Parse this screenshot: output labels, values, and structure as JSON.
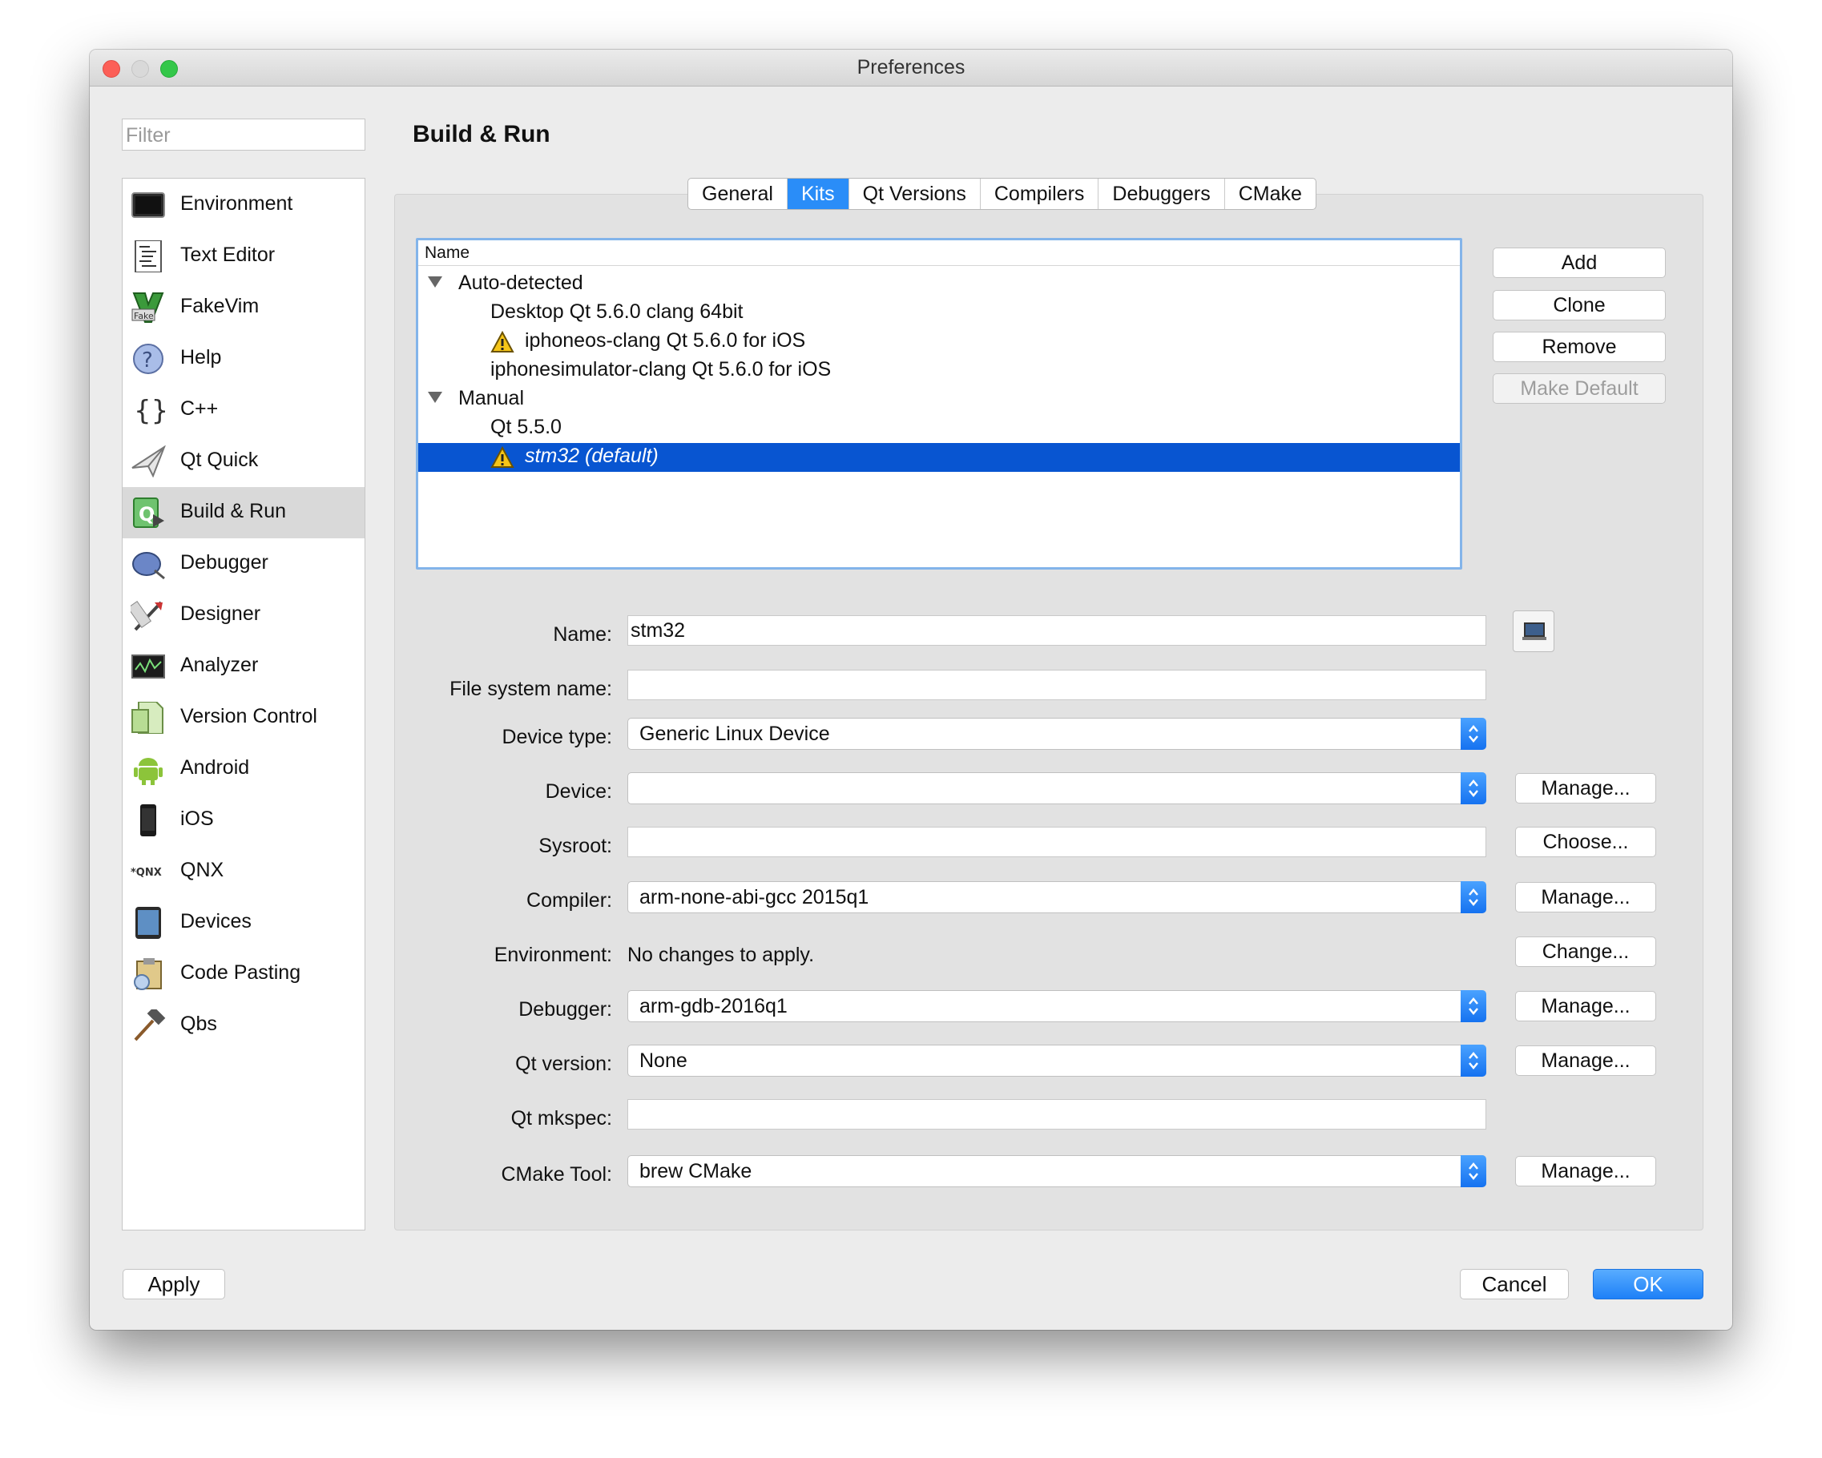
{
  "window": {
    "title": "Preferences"
  },
  "filter": {
    "placeholder": "Filter"
  },
  "sidebar": {
    "items": [
      {
        "label": "Environment",
        "icon": "environment-icon"
      },
      {
        "label": "Text Editor",
        "icon": "text-editor-icon"
      },
      {
        "label": "FakeVim",
        "icon": "fakevim-icon"
      },
      {
        "label": "Help",
        "icon": "help-icon"
      },
      {
        "label": "C++",
        "icon": "cpp-braces-icon"
      },
      {
        "label": "Qt Quick",
        "icon": "qt-quick-icon"
      },
      {
        "label": "Build & Run",
        "icon": "build-run-icon",
        "selected": true
      },
      {
        "label": "Debugger",
        "icon": "debugger-icon"
      },
      {
        "label": "Designer",
        "icon": "designer-icon"
      },
      {
        "label": "Analyzer",
        "icon": "analyzer-icon"
      },
      {
        "label": "Version Control",
        "icon": "version-control-icon"
      },
      {
        "label": "Android",
        "icon": "android-icon"
      },
      {
        "label": "iOS",
        "icon": "ios-device-icon"
      },
      {
        "label": "QNX",
        "icon": "qnx-icon"
      },
      {
        "label": "Devices",
        "icon": "devices-icon"
      },
      {
        "label": "Code Pasting",
        "icon": "code-pasting-icon"
      },
      {
        "label": "Qbs",
        "icon": "qbs-hammer-icon"
      }
    ]
  },
  "page": {
    "title": "Build & Run"
  },
  "tabs": [
    {
      "label": "General"
    },
    {
      "label": "Kits",
      "active": true
    },
    {
      "label": "Qt Versions"
    },
    {
      "label": "Compilers"
    },
    {
      "label": "Debuggers"
    },
    {
      "label": "CMake"
    }
  ],
  "kits_tree": {
    "header": "Name",
    "groups": [
      {
        "label": "Auto-detected",
        "items": [
          "Desktop Qt 5.6.0 clang 64bit",
          "iphoneos-clang Qt 5.6.0 for iOS",
          "iphonesimulator-clang Qt 5.6.0 for iOS"
        ]
      },
      {
        "label": "Manual",
        "items": [
          "Qt 5.5.0",
          "stm32 (default)"
        ]
      }
    ]
  },
  "kit_buttons": {
    "add": "Add",
    "clone": "Clone",
    "remove": "Remove",
    "make_default": "Make Default"
  },
  "form": {
    "name_label": "Name:",
    "name_value": "stm32",
    "fs_name_label": "File system name:",
    "fs_name_value": "",
    "device_type_label": "Device type:",
    "device_type_value": "Generic Linux Device",
    "device_label": "Device:",
    "device_value": "",
    "sysroot_label": "Sysroot:",
    "sysroot_value": "",
    "compiler_label": "Compiler:",
    "compiler_value": "arm-none-abi-gcc 2015q1",
    "environment_label": "Environment:",
    "environment_value": "No changes to apply.",
    "debugger_label": "Debugger:",
    "debugger_value": "arm-gdb-2016q1",
    "qt_version_label": "Qt version:",
    "qt_version_value": "None",
    "mkspec_label": "Qt mkspec:",
    "mkspec_value": "",
    "cmake_label": "CMake Tool:",
    "cmake_value": "brew CMake",
    "manage": "Manage...",
    "choose": "Choose...",
    "change": "Change..."
  },
  "footer": {
    "apply": "Apply",
    "cancel": "Cancel",
    "ok": "OK"
  },
  "colors": {
    "accent": "#2a8df8",
    "selection": "#0855d1",
    "window_bg": "#ececec"
  }
}
